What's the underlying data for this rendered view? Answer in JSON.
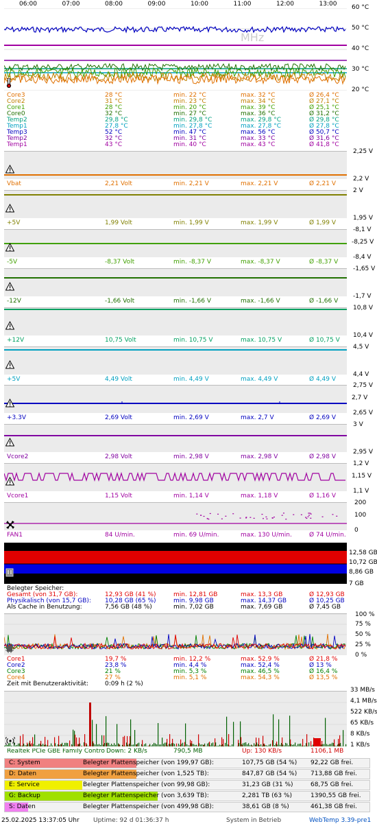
{
  "time_axis": [
    "06:00",
    "07:00",
    "08:00",
    "09:00",
    "10:00",
    "11:00",
    "12:00",
    "13:00"
  ],
  "watermark": "MHz",
  "temp": {
    "y_labels": [
      "60 °C",
      "50 °C",
      "40 °C",
      "30 °C",
      "20 °C"
    ],
    "rows": [
      {
        "name": "Core3",
        "cur": "28 °C",
        "min": "min. 22 °C",
        "max": "max. 32 °C",
        "avg": "Ø 26,4 °C",
        "color": "#e07000"
      },
      {
        "name": "Core2",
        "cur": "31 °C",
        "min": "min. 23 °C",
        "max": "max. 34 °C",
        "avg": "Ø 27,1 °C",
        "color": "#c08000"
      },
      {
        "name": "Core1",
        "cur": "28 °C",
        "min": "min. 20 °C",
        "max": "max. 39 °C",
        "avg": "Ø 25,1 °C",
        "color": "#40a000"
      },
      {
        "name": "Core0",
        "cur": "32 °C",
        "min": "min. 27 °C",
        "max": "max. 36 °C",
        "avg": "Ø 31,2 °C",
        "color": "#207000"
      },
      {
        "name": "Temp2",
        "cur": "29,8 °C",
        "min": "min. 29,8 °C",
        "max": "max. 29,8 °C",
        "avg": "Ø 29,8 °C",
        "color": "#00a080"
      },
      {
        "name": "Temp1",
        "cur": "27,8 °C",
        "min": "min. 27,8 °C",
        "max": "max. 27,8 °C",
        "avg": "Ø 27,8 °C",
        "color": "#00a0c0"
      },
      {
        "name": "Temp3",
        "cur": "52 °C",
        "min": "min. 47 °C",
        "max": "max. 56 °C",
        "avg": "Ø 50,7 °C",
        "color": "#0000c0"
      },
      {
        "name": "Temp2",
        "cur": "32 °C",
        "min": "min. 31 °C",
        "max": "max. 33 °C",
        "avg": "Ø 31,6 °C",
        "color": "#8000a0"
      },
      {
        "name": "Temp1",
        "cur": "43 °C",
        "min": "min. 40 °C",
        "max": "max. 43 °C",
        "avg": "Ø 41,8 °C",
        "color": "#a000a0"
      }
    ]
  },
  "voltages": [
    {
      "name": "Vbat",
      "cur": "2,21 Volt",
      "min": "min. 2,21 V",
      "max": "max. 2,21 V",
      "avg": "Ø 2,21 V",
      "color": "#e07000",
      "hi": "2,25 V",
      "lo": "2,2 V",
      "extra": ""
    },
    {
      "name": "+5V",
      "cur": "1,99 Volt",
      "min": "min. 1,99 V",
      "max": "max. 1,99 V",
      "avg": "Ø 1,99 V",
      "color": "#808000",
      "hi": "2 V",
      "lo": "1,95 V",
      "extra": ""
    },
    {
      "name": "-5V",
      "cur": "-8,37 Volt",
      "min": "min. -8,37 V",
      "max": "max. -8,37 V",
      "avg": "Ø -8,37 V",
      "color": "#40a000",
      "hi": "-8,1 V",
      "lo": "-8,4 V",
      "extra": "-8,25 V"
    },
    {
      "name": "-12V",
      "cur": "-1,66 Volt",
      "min": "min. -1,66 V",
      "max": "max. -1,66 V",
      "avg": "Ø -1,66 V",
      "color": "#207000",
      "hi": "-1,65 V",
      "lo": "-1,7 V",
      "extra": ""
    },
    {
      "name": "+12V",
      "cur": "10,75 Volt",
      "min": "min. 10,75 V",
      "max": "max. 10,75 V",
      "avg": "Ø 10,75 V",
      "color": "#00a060",
      "hi": "10,8 V",
      "lo": "10,4 V",
      "extra": ""
    },
    {
      "name": "+5V",
      "cur": "4,49 Volt",
      "min": "min. 4,49 V",
      "max": "max. 4,49 V",
      "avg": "Ø 4,49 V",
      "color": "#00a0c0",
      "hi": "4,5 V",
      "lo": "4,4 V",
      "extra": ""
    },
    {
      "name": "+3.3V",
      "cur": "2,69 Volt",
      "min": "min. 2,69 V",
      "max": "max. 2,7 V",
      "avg": "Ø 2,69 V",
      "color": "#0000c0",
      "hi": "2,75 V",
      "lo": "2,65 V",
      "extra": "2,7 V"
    },
    {
      "name": "Vcore2",
      "cur": "2,98 Volt",
      "min": "min. 2,98 V",
      "max": "max. 2,98 V",
      "avg": "Ø 2,98 V",
      "color": "#8000a0",
      "hi": "3 V",
      "lo": "2,95 V",
      "extra": ""
    },
    {
      "name": "Vcore1",
      "cur": "1,15 Volt",
      "min": "min. 1,14 V",
      "max": "max. 1,18 V",
      "avg": "Ø 1,16 V",
      "color": "#a000a0",
      "hi": "1,2 V",
      "lo": "1,1 V",
      "extra": "1,15 V"
    }
  ],
  "fan": {
    "name": "FAN1",
    "cur": "84 U/min.",
    "min": "min. 69 U/min.",
    "max": "max. 130 U/min.",
    "avg": "Ø 74 U/min.",
    "color": "#a000a0",
    "y_labels": [
      "200",
      "100",
      "0"
    ]
  },
  "memory": {
    "y_labels": [
      "12,58 GB",
      "10,72 GB",
      "8,86 GB",
      "7 GB"
    ],
    "title": "Belegter Speicher:",
    "rows": [
      {
        "name": "Gesamt (von 31,7 GB):",
        "cur": "12,93 GB (41 %)",
        "min": "min. 12,81 GB",
        "max": "max. 13,3 GB",
        "avg": "Ø 12,93 GB",
        "color": "#e00000"
      },
      {
        "name": "Physikalisch (von 15,7 GB):",
        "cur": "10,28 GB (65 %)",
        "min": "min. 9,98 GB",
        "max": "max. 14,37 GB",
        "avg": "Ø 10,25 GB",
        "color": "#0000c0"
      },
      {
        "name": "Als Cache in Benutzung:",
        "cur": "7,56 GB (48 %)",
        "min": "min. 7,02 GB",
        "max": "max. 7,69 GB",
        "avg": "Ø 7,45 GB",
        "color": "#000000"
      }
    ]
  },
  "cpu": {
    "y_labels": [
      "100 %",
      "75 %",
      "50 %",
      "25 %",
      "0 %"
    ],
    "rows": [
      {
        "name": "Core1",
        "cur": "19,7 %",
        "min": "min. 12,2 %",
        "max": "max. 52,9 %",
        "avg": "Ø 21,8 %",
        "color": "#e00000"
      },
      {
        "name": "Core2",
        "cur": "23,8 %",
        "min": "min. 4,4 %",
        "max": "max. 52,4 %",
        "avg": "Ø 13 %",
        "color": "#0000c0"
      },
      {
        "name": "Core3",
        "cur": "21 %",
        "min": "min. 5,3 %",
        "max": "max. 46,5 %",
        "avg": "Ø 16,4 %",
        "color": "#008000"
      },
      {
        "name": "Core4",
        "cur": "27 %",
        "min": "min. 5,1 %",
        "max": "max. 54,3 %",
        "avg": "Ø 13,5 %",
        "color": "#e07000"
      }
    ],
    "activity_label": "Zeit mit Benutzeraktivität:",
    "activity_value": "0:09 h (2 %)"
  },
  "network": {
    "y_labels": [
      "33 MB/s",
      "4,1 MB/s",
      "522 KB/s",
      "65 KB/s",
      "8 KB/s",
      "1 KB/s"
    ],
    "adapter": "Realtek PCIe GBE Family Contro",
    "down": "Down: 2 KB/s",
    "down_total": "790,5 MB",
    "up": "Up: 130 KB/s",
    "up_total": "1106,1 MB"
  },
  "disks": [
    {
      "label": "C: System",
      "desc": "Belegter Plattenspeicher (von 199,97 GB):",
      "used": "107,75 GB (54 %)",
      "free": "92,22 GB frei.",
      "color": "#f08080",
      "pct": 0.54
    },
    {
      "label": "D: Daten",
      "desc": "Belegter Plattenspeicher (von 1,525 TB):",
      "used": "847,87 GB (54 %)",
      "free": "713,88 GB frei.",
      "color": "#f0a040",
      "pct": 0.54
    },
    {
      "label": "E: Service",
      "desc": "Belegter Plattenspeicher (von 99,98 GB):",
      "used": "31,23 GB (31 %)",
      "free": "68,75 GB frei.",
      "color": "#f0f000",
      "pct": 0.31
    },
    {
      "label": "G: Backup",
      "desc": "Belegter Plattenspeicher (von 3,639 TB):",
      "used": "2,281 TB (63 %)",
      "free": "1390,55 GB frei.",
      "color": "#a0e000",
      "pct": 0.63
    },
    {
      "label": "S: Daten",
      "desc": "Belegter Plattenspeicher (von 499,98 GB):",
      "used": "38,61 GB (8 %)",
      "free": "461,38 GB frei.",
      "color": "#f080f0",
      "pct": 0.08
    }
  ],
  "footer": {
    "datetime": "25.02.2025 13:37:05 Uhr",
    "uptime": "Uptime: 92 d 01:36:37 h",
    "status": "System in Betrieb",
    "app": "WebTemp 3.39-pre1"
  }
}
